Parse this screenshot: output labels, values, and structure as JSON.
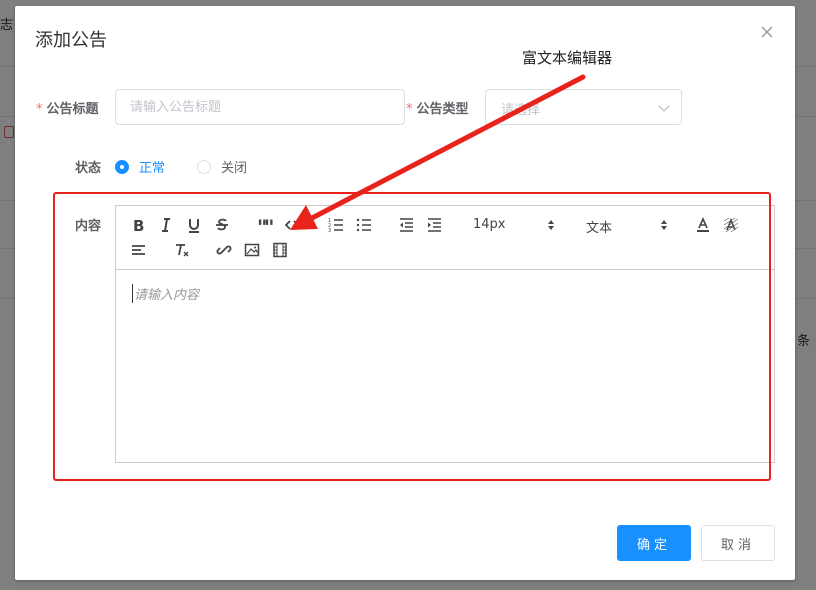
{
  "background": {
    "tab_text": "志",
    "side_text": "条"
  },
  "dialog": {
    "title": "添加公告",
    "form": {
      "title_label": "公告标题",
      "title_placeholder": "请输入公告标题",
      "type_label": "公告类型",
      "type_placeholder": "请选择",
      "status_label": "状态",
      "status_options": [
        {
          "label": "正常",
          "checked": true
        },
        {
          "label": "关闭",
          "checked": false
        }
      ],
      "content_label": "内容",
      "required_mark": "*"
    },
    "editor": {
      "font_size": "14px",
      "header_select": "文本",
      "placeholder": "请输入内容",
      "toolbar_icons": [
        "bold-icon",
        "italic-icon",
        "underline-icon",
        "strike-icon",
        "blockquote-icon",
        "code-icon",
        "ordered-list-icon",
        "bullet-list-icon",
        "outdent-icon",
        "indent-icon",
        "font-color-icon",
        "background-color-icon",
        "align-icon",
        "clean-format-icon",
        "link-icon",
        "image-icon",
        "video-icon"
      ]
    },
    "buttons": {
      "confirm": "确定",
      "cancel": "取消"
    }
  },
  "annotation": {
    "text": "富文本编辑器",
    "color": "#e8231b"
  },
  "colors": {
    "primary": "#1890ff",
    "required": "#f56c6c",
    "highlight": "#e8231b"
  }
}
